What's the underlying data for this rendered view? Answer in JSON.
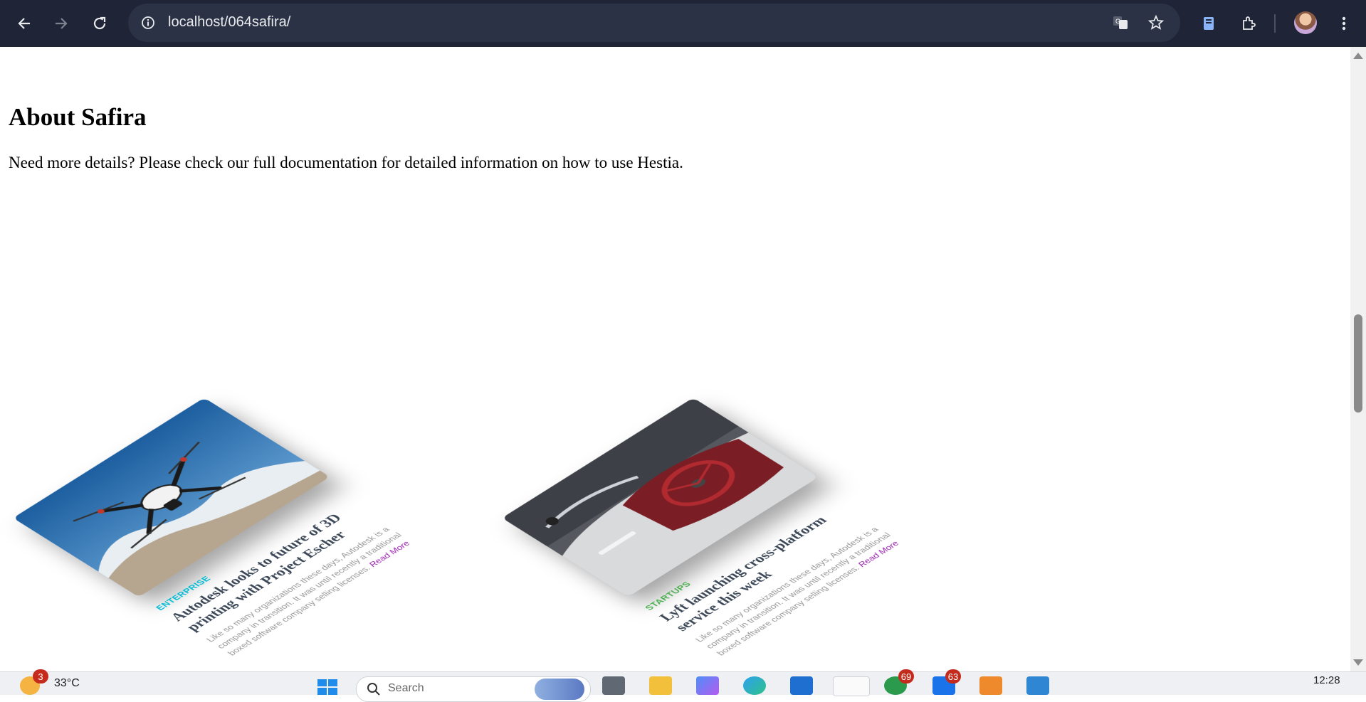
{
  "browser": {
    "url": "localhost/064safira/"
  },
  "page": {
    "title": "About Safira",
    "description": "Need more details? Please check our full documentation for detailed information on how to use Hestia."
  },
  "cards": [
    {
      "category": "ENTERPRISE",
      "category_color": "#00bcd4",
      "title": "Autodesk looks to future of 3D printing with Project Escher",
      "text": "Like so many organizations these days, Autodesk is a company in transition. It was until recently a traditional boxed software company selling licenses.",
      "read_more": "Read More",
      "image": "drone-photo"
    },
    {
      "category": "STARTUPS",
      "category_color": "#4caf50",
      "title": "Lyft launching cross-platform service this week",
      "text": "Like so many organizations these days, Autodesk is a company in transition. It was until recently a traditional boxed software company selling licenses.",
      "read_more": "Read More",
      "image": "vintage-car-photo"
    }
  ],
  "taskbar": {
    "weather_badge": "3",
    "temperature": "33°C",
    "search_placeholder": "Search",
    "badges": [
      "69",
      "63"
    ],
    "clock": "12:28"
  }
}
